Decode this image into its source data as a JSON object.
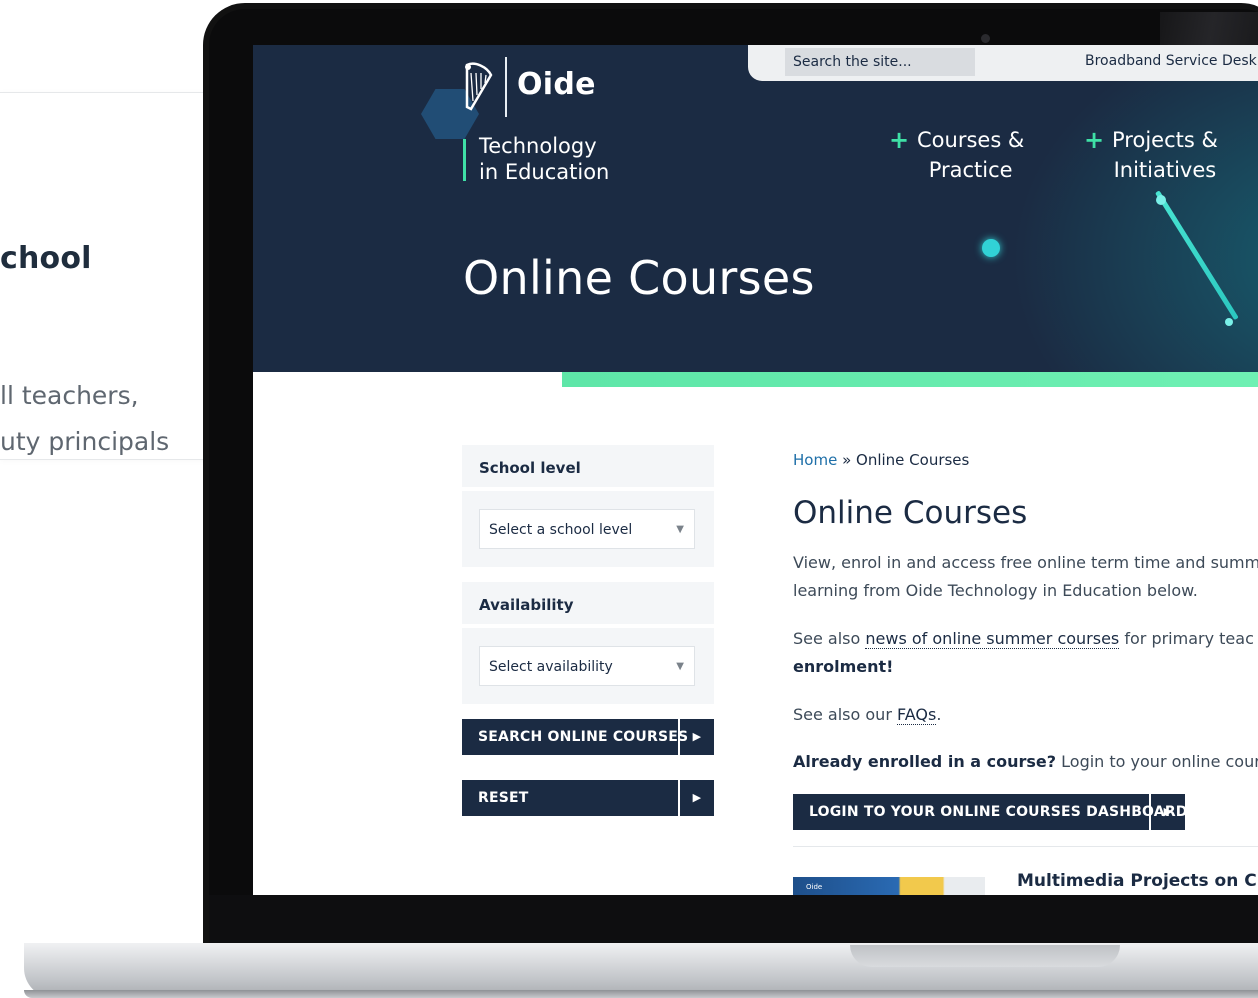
{
  "background_card": {
    "title": "chool",
    "desc_line1": "ll teachers,",
    "desc_line2": "uty principals"
  },
  "header": {
    "logo_word": "Oide",
    "logo_sub_line1": "Technology",
    "logo_sub_line2": "in Education",
    "search_placeholder": "Search the site...",
    "topbar_link": "Broadband Service Desk",
    "nav": [
      {
        "line1": "Courses &",
        "line2": "Practice"
      },
      {
        "line1": "Projects &",
        "line2": "Initiatives"
      }
    ],
    "hero_title": "Online Courses"
  },
  "filters": {
    "school_level": {
      "label": "School level",
      "select": "Select a school level"
    },
    "availability": {
      "label": "Availability",
      "select": "Select availability"
    },
    "search_button": "SEARCH ONLINE COURSES",
    "reset_button": "RESET"
  },
  "content": {
    "breadcrumb_home": "Home",
    "breadcrumb_sep": " » ",
    "breadcrumb_current": "Online Courses",
    "title": "Online Courses",
    "intro_line1": "View, enrol in and access free online term time and summ",
    "intro_line2": "learning from Oide Technology in Education below.",
    "see_also_pre": "See also ",
    "see_also_link": "news of online summer courses",
    "see_also_post": " for primary teac",
    "enrolment": "enrolment!",
    "faq_pre": "See also our ",
    "faq_link": "FAQs",
    "faq_post": ".",
    "already_bold": "Already enrolled in a course?",
    "already_rest": " Login to your online course",
    "login_button": "LOGIN TO YOUR ONLINE COURSES DASHBOARD",
    "thumb_logo": "Oide",
    "teaser_title": "Multimedia Projects on Clima"
  }
}
